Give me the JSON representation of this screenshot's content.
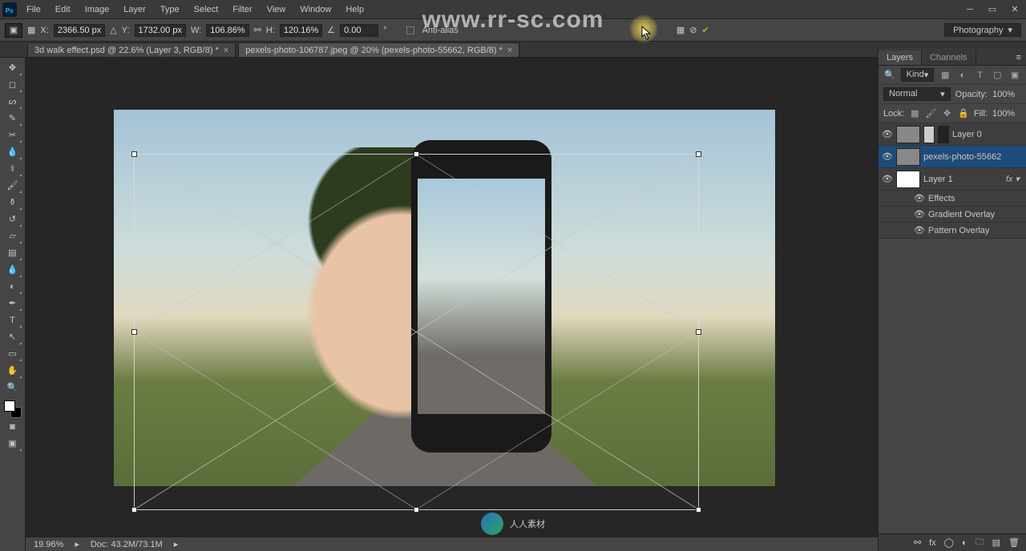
{
  "menu": [
    "File",
    "Edit",
    "Image",
    "Layer",
    "Type",
    "Select",
    "Filter",
    "View",
    "Window",
    "Help"
  ],
  "options": {
    "x_label": "X:",
    "x_value": "2366.50 px",
    "y_label": "Y:",
    "y_value": "1732.00 px",
    "w_label": "W:",
    "w_value": "106.86%",
    "h_label": "H:",
    "h_value": "120.16%",
    "angle_value": "0.00",
    "antialias_label": "Anti-alias",
    "workspace": "Photography"
  },
  "tabs": [
    {
      "title": "3d walk effect.psd @ 22.6% (Layer 3, RGB/8) *",
      "active": false
    },
    {
      "title": "pexels-photo-106787.jpeg @ 20% (pexels-photo-55662, RGB/8) *",
      "active": true
    }
  ],
  "status": {
    "zoom": "19.96%",
    "doc": "Doc: 43.2M/73.1M"
  },
  "panels": {
    "tabs": [
      "Layers",
      "Channels"
    ],
    "kind_label": "Kind",
    "blend_mode": "Normal",
    "opacity_label": "Opacity:",
    "opacity_value": "100%",
    "lock_label": "Lock:",
    "fill_label": "Fill:",
    "fill_value": "100%"
  },
  "layers": [
    {
      "name": "Layer 0",
      "visible": true,
      "selected": false,
      "thumb": "img"
    },
    {
      "name": "pexels-photo-55662",
      "visible": true,
      "selected": true,
      "thumb": "img"
    },
    {
      "name": "Layer 1",
      "visible": true,
      "selected": false,
      "thumb": "white",
      "fx": true
    },
    {
      "name": "Effects",
      "sub": true,
      "visible": true
    },
    {
      "name": "Gradient Overlay",
      "sub": true,
      "visible": true
    },
    {
      "name": "Pattern Overlay",
      "sub": true,
      "visible": true
    }
  ],
  "watermarks": {
    "top": "www.rr-sc.com",
    "bottom": "人人素材"
  }
}
